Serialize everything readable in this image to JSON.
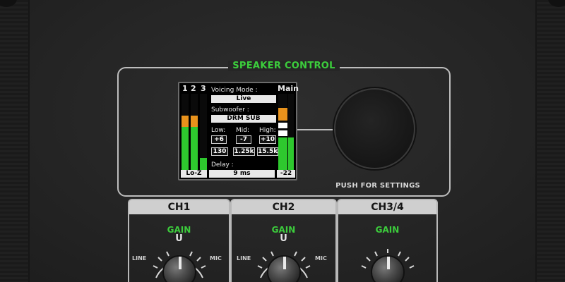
{
  "speaker_control": {
    "title": "SPEAKER CONTROL",
    "push_label": "PUSH FOR SETTINGS"
  },
  "lcd": {
    "meter_numbers": [
      "1",
      "2",
      "3"
    ],
    "main_label": "Main",
    "voicing_mode_label": "Voicing Mode :",
    "voicing_mode_value": "Live",
    "subwoofer_label": "Subwoofer :",
    "subwoofer_value": "DRM SUB",
    "eq": {
      "low_label": "Low:",
      "mid_label": "Mid:",
      "high_label": "High:",
      "low_gain": "+6",
      "mid_gain": "-7",
      "high_gain": "+10",
      "low_freq": "130",
      "mid_freq": "1.25k",
      "high_freq": "15.5k"
    },
    "delay_label": "Delay :",
    "delay_value": "9 ms",
    "input_mode": "Lo-Z",
    "main_level": "-22",
    "meters": {
      "ch1": 0.72,
      "ch2": 0.72,
      "ch3": 0.18,
      "main": 0.55
    }
  },
  "channels": [
    {
      "name": "CH1",
      "gain_label": "GAIN",
      "unity": "U",
      "line_label": "LINE",
      "mic_label": "MIC"
    },
    {
      "name": "CH2",
      "gain_label": "GAIN",
      "unity": "U",
      "line_label": "LINE",
      "mic_label": "MIC"
    },
    {
      "name": "CH3/4",
      "gain_label": "GAIN"
    }
  ],
  "colors": {
    "accent_green": "#3ccd3c",
    "meter_green": "#2ec82e",
    "meter_orange": "#e8921c"
  }
}
